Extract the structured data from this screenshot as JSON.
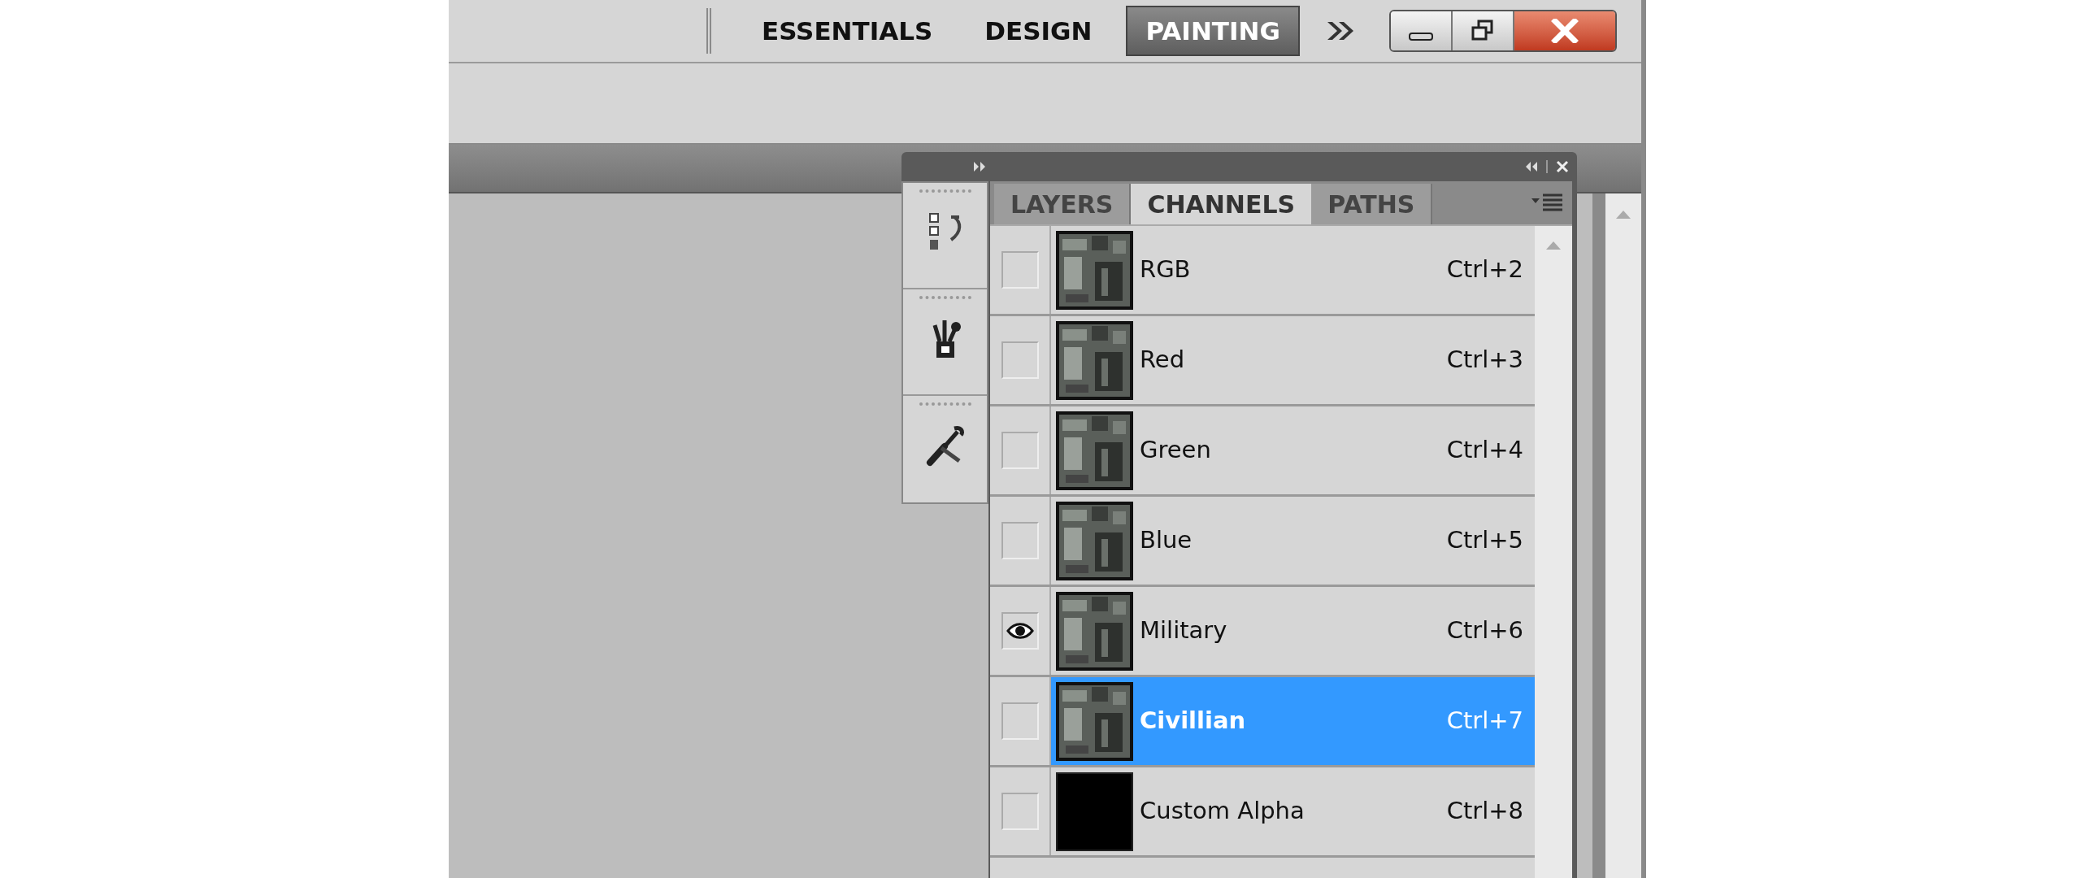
{
  "workspaces": [
    {
      "label": "ESSENTIALS",
      "selected": false
    },
    {
      "label": "DESIGN",
      "selected": false
    },
    {
      "label": "PAINTING",
      "selected": true
    }
  ],
  "panel": {
    "tabs": [
      {
        "label": "LAYERS",
        "selected": false
      },
      {
        "label": "CHANNELS",
        "selected": true
      },
      {
        "label": "PATHS",
        "selected": false
      }
    ],
    "channels": [
      {
        "name": "RGB",
        "shortcut": "Ctrl+2",
        "visible": false,
        "selected": false,
        "kind": "picture"
      },
      {
        "name": "Red",
        "shortcut": "Ctrl+3",
        "visible": false,
        "selected": false,
        "kind": "picture"
      },
      {
        "name": "Green",
        "shortcut": "Ctrl+4",
        "visible": false,
        "selected": false,
        "kind": "picture"
      },
      {
        "name": "Blue",
        "shortcut": "Ctrl+5",
        "visible": false,
        "selected": false,
        "kind": "picture"
      },
      {
        "name": "Military",
        "shortcut": "Ctrl+6",
        "visible": true,
        "selected": false,
        "kind": "picture"
      },
      {
        "name": "Civillian",
        "shortcut": "Ctrl+7",
        "visible": false,
        "selected": true,
        "kind": "picture"
      },
      {
        "name": "Custom Alpha",
        "shortcut": "Ctrl+8",
        "visible": false,
        "selected": false,
        "kind": "solid"
      }
    ]
  }
}
